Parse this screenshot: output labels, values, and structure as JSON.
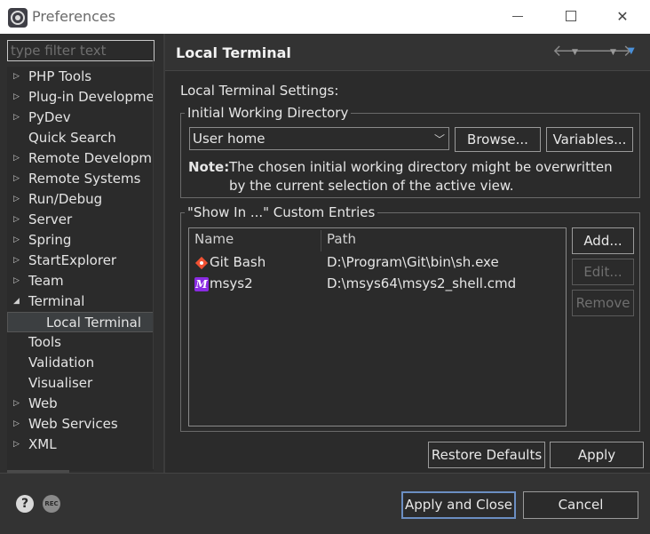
{
  "window": {
    "title": "Preferences",
    "minimize_label": "",
    "close_label": "✕"
  },
  "filter": {
    "placeholder": "type filter text"
  },
  "tree": {
    "items": [
      {
        "label": "PHP Tools",
        "expandable": true
      },
      {
        "label": "Plug-in Developme",
        "expandable": true
      },
      {
        "label": "PyDev",
        "expandable": true
      },
      {
        "label": "Quick Search",
        "expandable": false
      },
      {
        "label": "Remote Developm",
        "expandable": true
      },
      {
        "label": "Remote Systems",
        "expandable": true
      },
      {
        "label": "Run/Debug",
        "expandable": true
      },
      {
        "label": "Server",
        "expandable": true
      },
      {
        "label": "Spring",
        "expandable": true
      },
      {
        "label": "StartExplorer",
        "expandable": true
      },
      {
        "label": "Team",
        "expandable": true
      },
      {
        "label": "Terminal",
        "expandable": true,
        "expanded": true
      },
      {
        "label": "Local Terminal",
        "child": true,
        "selected": true
      },
      {
        "label": "Tools",
        "expandable": false
      },
      {
        "label": "Validation",
        "expandable": false
      },
      {
        "label": "Visualiser",
        "expandable": false
      },
      {
        "label": "Web",
        "expandable": true
      },
      {
        "label": "Web Services",
        "expandable": true
      },
      {
        "label": "XML",
        "expandable": true
      }
    ]
  },
  "page": {
    "title": "Local Terminal",
    "settings_label": "Local Terminal Settings:",
    "initial_dir": {
      "group_title": "Initial Working Directory",
      "combo_value": "User home",
      "browse_label": "Browse...",
      "variables_label": "Variables...",
      "note_label": "Note:",
      "note_text": "The chosen initial working directory might be overwritten by the current selection of the active view."
    },
    "show_in": {
      "group_title": "\"Show In ...\" Custom Entries",
      "columns": [
        "Name",
        "Path"
      ],
      "rows": [
        {
          "name": "Git Bash",
          "path": "D:\\Program\\Git\\bin\\sh.exe",
          "icon": "git-icon"
        },
        {
          "name": "msys2",
          "path": "D:\\msys64\\msys2_shell.cmd",
          "icon": "msys2-icon",
          "icon_letter": "M"
        }
      ],
      "add_label": "Add...",
      "edit_label": "Edit...",
      "remove_label": "Remove"
    },
    "restore_defaults_label": "Restore Defaults",
    "apply_label": "Apply"
  },
  "footer": {
    "help_glyph": "?",
    "rec_glyph": "REC",
    "apply_close_label": "Apply and Close",
    "cancel_label": "Cancel"
  },
  "colors": {
    "background": "#2b2b2b",
    "titlebar": "#ffffff",
    "default_button_border": "#6b8ec2",
    "git_icon": "#f05133",
    "msys_icon": "#8a2be2"
  }
}
